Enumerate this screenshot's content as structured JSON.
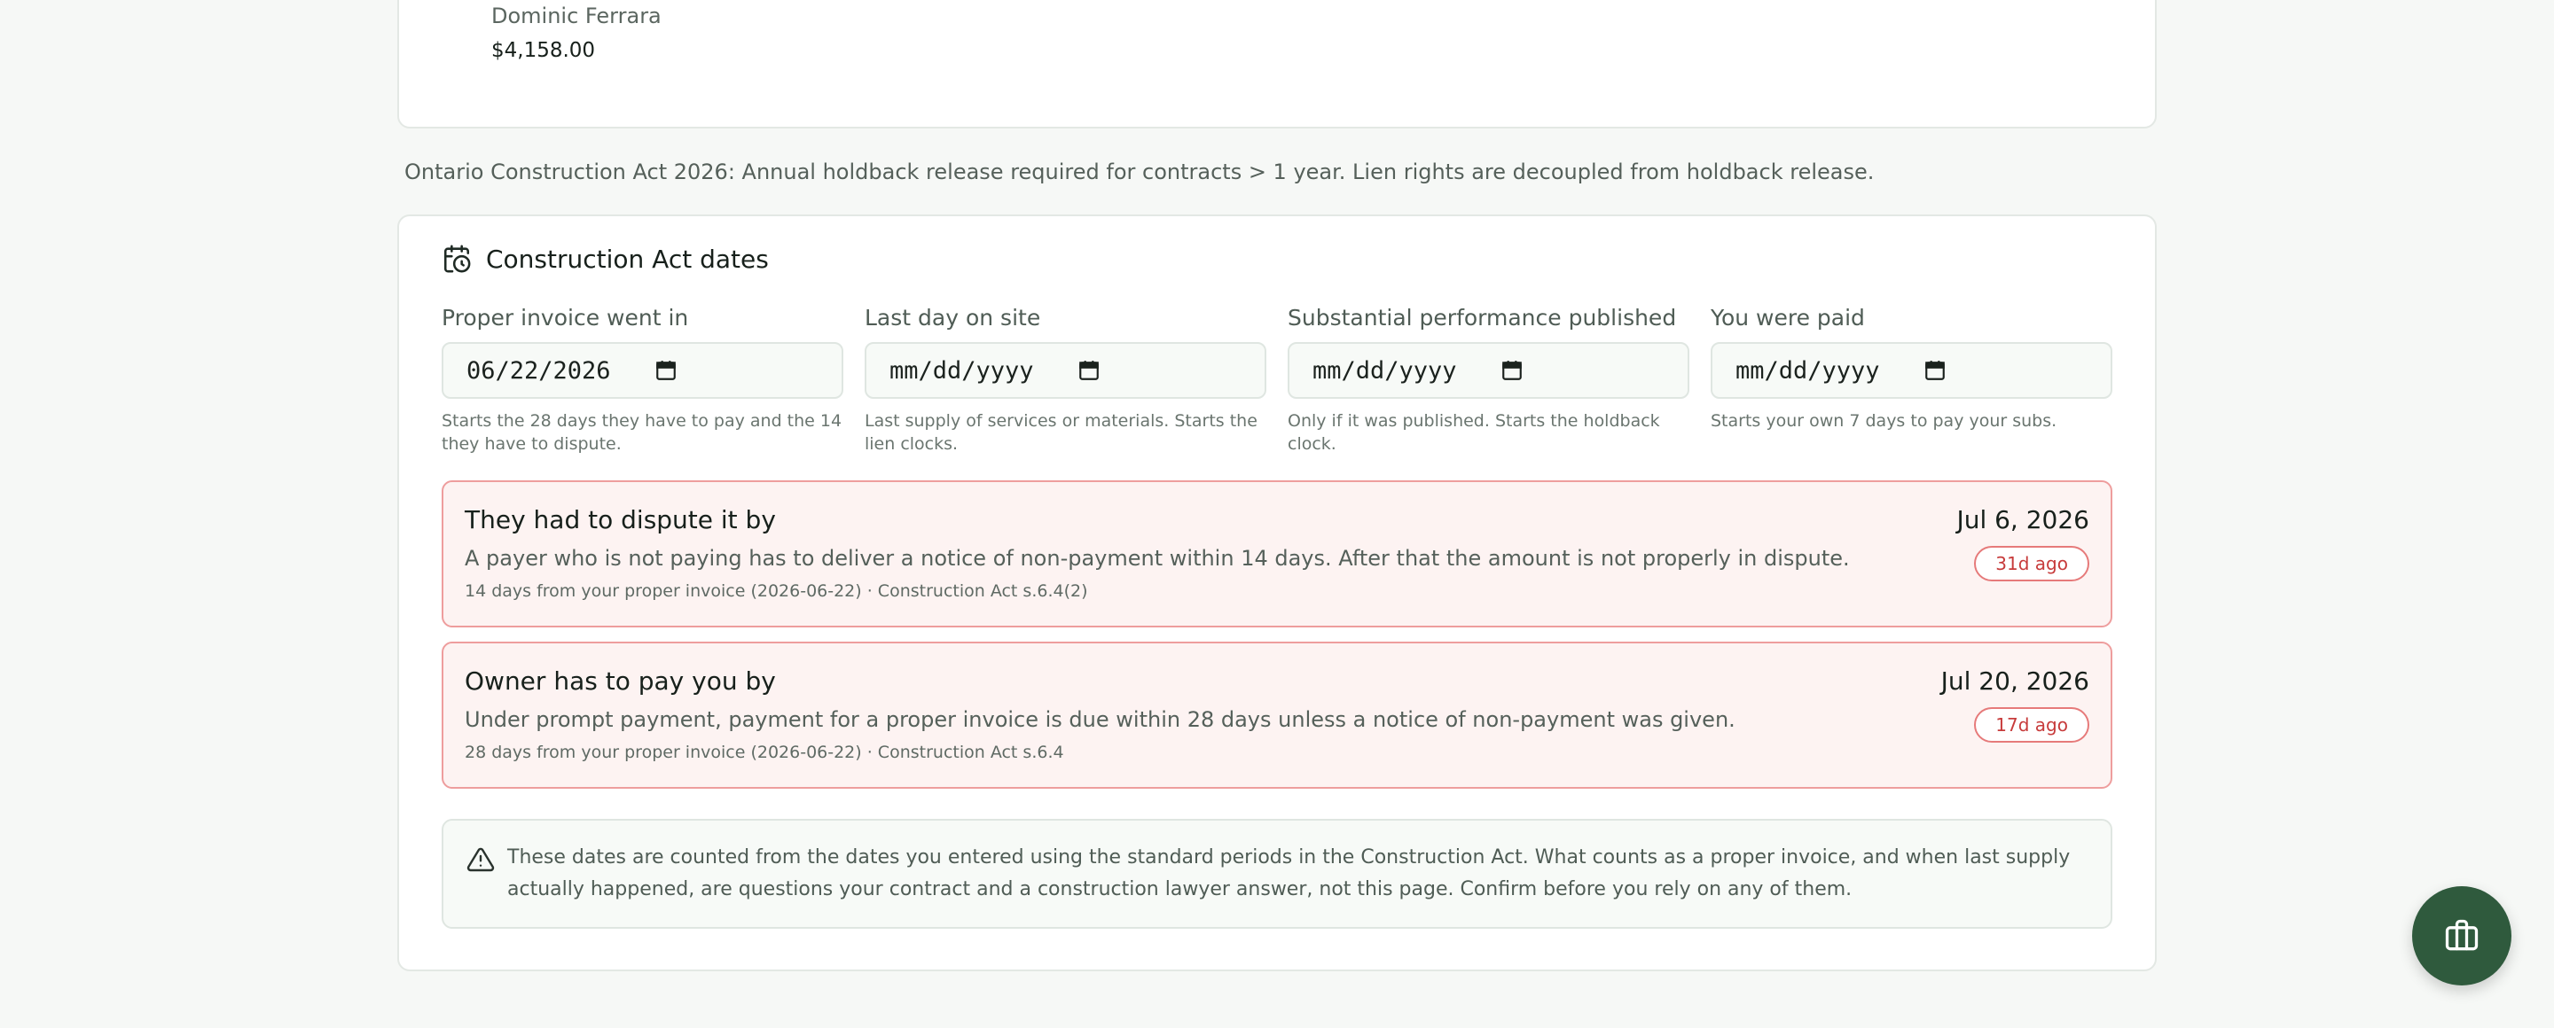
{
  "contact": {
    "name": "Dominic Ferrara",
    "amount": "$4,158.00"
  },
  "act_note": "Ontario Construction Act 2026: Annual holdback release required for contracts > 1 year. Lien rights are decoupled from holdback release.",
  "section": {
    "title": "Construction Act dates",
    "icon": "calendar-clock-icon"
  },
  "fields": [
    {
      "label": "Proper invoice went in",
      "value": "06/22/2026",
      "hint": "Starts the 28 days they have to pay and the 14 they have to dispute."
    },
    {
      "label": "Last day on site",
      "value": "mm/dd/yyyy",
      "hint": "Last supply of services or materials. Starts the lien clocks."
    },
    {
      "label": "Substantial performance published",
      "value": "mm/dd/yyyy",
      "hint": "Only if it was published. Starts the holdback clock."
    },
    {
      "label": "You were paid",
      "value": "mm/dd/yyyy",
      "hint": "Starts your own 7 days to pay your subs."
    }
  ],
  "deadlines": [
    {
      "title": "They had to dispute it by",
      "description": "A payer who is not paying has to deliver a notice of non-payment within 14 days. After that the amount is not properly in dispute.",
      "meta": "14 days from your proper invoice (2026-06-22) · Construction Act s.6.4(2)",
      "date": "Jul 6, 2026",
      "badge": "31d ago"
    },
    {
      "title": "Owner has to pay you by",
      "description": "Under prompt payment, payment for a proper invoice is due within 28 days unless a notice of non-payment was given.",
      "meta": "28 days from your proper invoice (2026-06-22) · Construction Act s.6.4",
      "date": "Jul 20, 2026",
      "badge": "17d ago"
    }
  ],
  "disclaimer": {
    "icon": "warning-icon",
    "text": "These dates are counted from the dates you entered using the standard periods in the Construction Act. What counts as a proper invoice, and when last supply actually happened, are questions your contract and a construction lawyer answer, not this page. Confirm before you rely on any of them."
  },
  "fab": {
    "icon": "toolbox-icon"
  },
  "colors": {
    "accent": "#2f5a3d",
    "overdue_border": "#ee9d9d",
    "overdue_bg": "#fdf3f2",
    "overdue_text": "#c73b3b"
  }
}
